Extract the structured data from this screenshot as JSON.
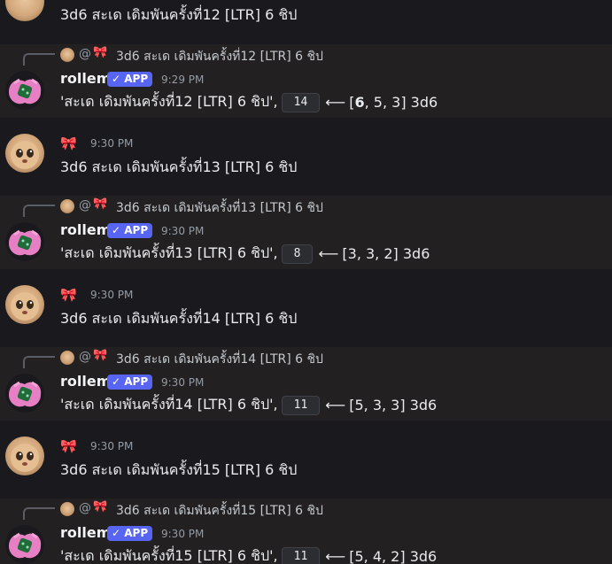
{
  "messages": [
    {
      "kind": "user",
      "time": "",
      "content": "3d6  สะเด เดิมพันครั้งที่12 [LTR] 6 ชิป"
    },
    {
      "kind": "bot",
      "reply_text": "3d6  สะเด เดิมพันครั้งที่12 [LTR] 6 ชิป",
      "name": "rollem",
      "badge": "✓ APP",
      "time": "9:29 PM",
      "label": "'สะเด เดิมพันครั้งที่12 [LTR] 6 ชิป',",
      "total": "14",
      "dice_open": "[",
      "dice_bold": "6",
      "dice_rest": ", 5, 3] 3d6"
    },
    {
      "kind": "user",
      "time": "9:30 PM",
      "content": "3d6  สะเด เดิมพันครั้งที่13 [LTR] 6 ชิป"
    },
    {
      "kind": "bot",
      "reply_text": "3d6  สะเด เดิมพันครั้งที่13 [LTR] 6 ชิป",
      "name": "rollem",
      "badge": "✓ APP",
      "time": "9:30 PM",
      "label": "'สะเด เดิมพันครั้งที่13 [LTR] 6 ชิป',",
      "total": "8",
      "dice_open": "[3, 3, 2] 3d6",
      "dice_bold": "",
      "dice_rest": ""
    },
    {
      "kind": "user",
      "time": "9:30 PM",
      "content": "3d6  สะเด เดิมพันครั้งที่14 [LTR] 6 ชิป"
    },
    {
      "kind": "bot",
      "reply_text": "3d6  สะเด เดิมพันครั้งที่14 [LTR] 6 ชิป",
      "name": "rollem",
      "badge": "✓ APP",
      "time": "9:30 PM",
      "label": "'สะเด เดิมพันครั้งที่14 [LTR] 6 ชิป',",
      "total": "11",
      "dice_open": "[5, 3, 3] 3d6",
      "dice_bold": "",
      "dice_rest": ""
    },
    {
      "kind": "user",
      "time": "9:30 PM",
      "content": "3d6  สะเด เดิมพันครั้งที่15 [LTR] 6 ชิป"
    },
    {
      "kind": "bot",
      "reply_text": "3d6  สะเด เดิมพันครั้งที่15 [LTR] 6 ชิป",
      "name": "rollem",
      "badge": "✓ APP",
      "time": "9:30 PM",
      "label": "'สะเด เดิมพันครั้งที่15 [LTR] 6 ชิป',",
      "total": "11",
      "dice_open": "[5, 4, 2] 3d6",
      "dice_bold": "",
      "dice_rest": ""
    }
  ],
  "reply_prefix": "@",
  "bow_glyph": "🎀",
  "arrow": "⟵",
  "colors": {
    "background": "#1a1a1e",
    "bot_row": "#222021",
    "app_badge": "#5865f2",
    "bow": "#e04a5f"
  }
}
